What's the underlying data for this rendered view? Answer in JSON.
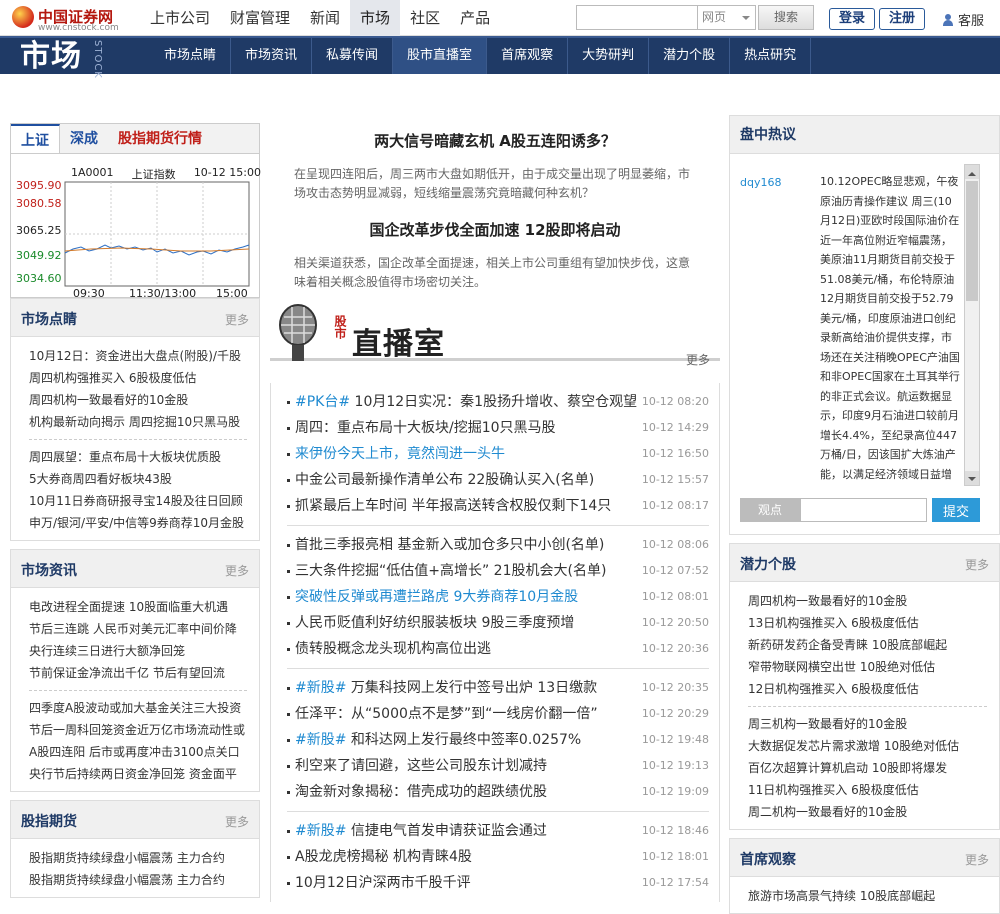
{
  "logo": {
    "name": "中国证券网",
    "sub": "www.cnstock.com"
  },
  "mainnav": [
    "上市公司",
    "财富管理",
    "新闻",
    "市场",
    "社区",
    "产品"
  ],
  "search": {
    "value": "",
    "select": "网页",
    "button": "搜索"
  },
  "auth": {
    "login": "登录",
    "register": "注册",
    "user": "客服"
  },
  "band": {
    "title": "市场",
    "stock": "STOCK"
  },
  "subnav": [
    "市场点睛",
    "市场资讯",
    "私募传闻",
    "股市直播室",
    "首席观察",
    "大势研判",
    "潜力个股",
    "热点研究"
  ],
  "index": {
    "tabs": [
      "上证",
      "深成",
      "股指期货行情"
    ],
    "code": "1A0001",
    "name": "上证指数",
    "date": "10-12 15:00",
    "y_labels": [
      "3095.90",
      "3080.58",
      "3065.25",
      "3049.92",
      "3034.60"
    ],
    "x_labels": [
      "09:30",
      "11:30/13:00",
      "15:00"
    ]
  },
  "market_focus": {
    "title": "市场点睛",
    "more": "更多",
    "group1": [
      "10月12日：资金进出大盘点(附股)/千股",
      "周四机构强推买入 6股极度低估",
      "周四机构一致最看好的10金股",
      "机构最新动向揭示 周四挖掘10只黑马股"
    ],
    "group2": [
      "周四展望：重点布局十大板块优质股",
      "5大券商周四看好板块43股",
      "10月11日券商研报寻宝14股及往日回顾",
      "申万/银河/平安/中信等9券商荐10月金股"
    ]
  },
  "market_news": {
    "title": "市场资讯",
    "more": "更多",
    "group1": [
      "电改进程全面提速 10股面临重大机遇",
      "节后三连跳 人民币对美元汇率中间价降",
      "央行连续三日进行大额净回笼",
      "节前保证金净流出千亿 节后有望回流"
    ],
    "group2": [
      "四季度A股波动或加大基金关注三大投资",
      "节后一周科回笼资金近万亿市场流动性或",
      "A股四连阳 后市或再度冲击3100点关口",
      "央行节后持续两日资金净回笼 资金面平"
    ]
  },
  "futures": {
    "title": "股指期货",
    "more": "更多",
    "items": [
      "股指期货持续绿盘小幅震荡 主力合约",
      "股指期货持续绿盘小幅震荡 主力合约"
    ]
  },
  "headline1": {
    "title": "两大信号暗藏玄机 A股五连阳诱多？",
    "summary": "在呈现四连阳后，周三两市大盘如期低开，由于成交量出现了明显萎缩，市场攻击态势明显减弱，短线缩量震荡究竟暗藏何种玄机？"
  },
  "headline2": {
    "title": "国企改革步伐全面加速 12股即将启动",
    "summary": "相关渠道获悉，国企改革全面提速，相关上市公司重组有望加快步伐，这意味着相关概念股值得市场密切关注。"
  },
  "live": {
    "small": "股市",
    "title": "直播室",
    "more": "更多"
  },
  "news": [
    [
      {
        "tag": "#PK台#",
        "t": " 10月12日实况：秦1股扬升增收、蔡空仓观望",
        "d": "10-12 08:20"
      },
      {
        "tag": "",
        "t": "周四：重点布局十大板块/挖掘10只黑马股",
        "d": "10-12 14:29"
      },
      {
        "tag": "",
        "t": "来伊份今天上市，竟然闯进一头牛",
        "d": "10-12 16:50",
        "blue": true
      },
      {
        "tag": "",
        "t": "中金公司最新操作清单公布 22股确认买入(名单)",
        "d": "10-12 15:57"
      },
      {
        "tag": "",
        "t": "抓紧最后上车时间 半年报高送转含权股仅剩下14只",
        "d": "10-12 08:17"
      }
    ],
    [
      {
        "tag": "",
        "t": "首批三季报亮相 基金新入或加仓多只中小创(名单)",
        "d": "10-12 08:06"
      },
      {
        "tag": "",
        "t": "三大条件挖掘“低估值+高增长” 21股机会大(名单)",
        "d": "10-12 07:52"
      },
      {
        "tag": "",
        "t": "突破性反弹或再遭拦路虎 9大券商荐10月金股",
        "d": "10-12 08:01",
        "blue": true
      },
      {
        "tag": "",
        "t": "人民币贬值利好纺织服装板块 9股三季度预增",
        "d": "10-12 20:50"
      },
      {
        "tag": "",
        "t": "债转股概念龙头现机构高位出逃",
        "d": "10-12 20:36"
      }
    ],
    [
      {
        "tag": "#新股#",
        "t": " 万集科技网上发行中签号出炉 13日缴款",
        "d": "10-12 20:35"
      },
      {
        "tag": "",
        "t": "任泽平：从“5000点不是梦”到“一线房价翻一倍”",
        "d": "10-12 20:29"
      },
      {
        "tag": "#新股#",
        "t": " 和科达网上发行最终中签率0.0257%",
        "d": "10-12 19:48"
      },
      {
        "tag": "",
        "t": "利空来了请回避，这些公司股东计划减持",
        "d": "10-12 19:13"
      },
      {
        "tag": "",
        "t": "淘金新对象揭秘：借壳成功的超跌绩优股",
        "d": "10-12 19:09"
      }
    ],
    [
      {
        "tag": "#新股#",
        "t": " 信捷电气首发申请获证监会通过",
        "d": "10-12 18:46"
      },
      {
        "tag": "",
        "t": "A股龙虎榜揭秘 机构青睐4股",
        "d": "10-12 18:01"
      },
      {
        "tag": "",
        "t": "10月12日沪深两市千股千评",
        "d": "10-12 17:54"
      }
    ]
  ],
  "hot": {
    "title": "盘中热议",
    "user": "dqy168",
    "text": "10.12OPEC略显悲观，午夜原油历青操作建议 周三(10月12日)亚欧时段国际油价在近一年高位附近窄幅震荡，美原油11月期货目前交投于51.08美元/桶，布伦特原油12月期货目前交投于52.79美元/桶，印度原油进口创纪录新高给油价提供支撑，市场还在关注稍晚OPEC产油国和非OPEC国家在土耳其举行的非正式会议。航运数据显示，印度9月石油进口较前月增长4.4%，至纪录高位447万桶/日，因该国扩大炼油产能，以满足经济领域日益增长的燃料需求。此外，近期市场因为俄",
    "label": "观点",
    "submit": "提交"
  },
  "potential": {
    "title": "潜力个股",
    "more": "更多",
    "group1": [
      "周四机构一致最看好的10金股",
      "13日机构强推买入 6股极度低估",
      "新药研发药企备受青睐 10股底部崛起",
      "窄带物联网横空出世 10股绝对低估",
      "12日机构强推买入 6股极度低估"
    ],
    "group2": [
      "周三机构一致最看好的10金股",
      "大数据促发芯片需求激增 10股绝对低估",
      "百亿次超算计算机启动 10股即将爆发",
      "11日机构强推买入 6股极度低估",
      "周二机构一致最看好的10金股"
    ]
  },
  "chief": {
    "title": "首席观察",
    "more": "更多",
    "items": [
      "旅游市场高景气持续 10股底部崛起"
    ]
  },
  "colors": {
    "navy": "#1f3a66",
    "blue": "#1f8ad0",
    "red": "#c0201a"
  }
}
